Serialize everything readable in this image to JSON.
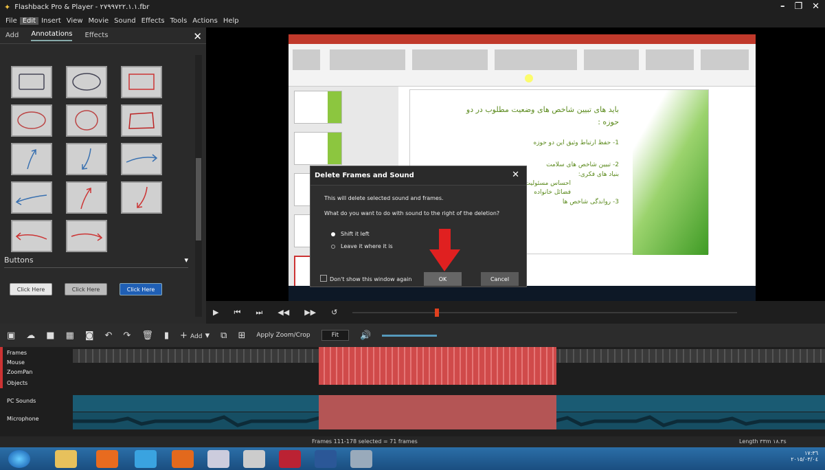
{
  "window": {
    "title": "Flashback Pro & Player - ٢٧٩٩٧٢٢.١.١.fbr",
    "min": "–",
    "max": "❐",
    "close": "✕"
  },
  "menu": [
    "File",
    "Edit",
    "Insert",
    "View",
    "Movie",
    "Sound",
    "Effects",
    "Tools",
    "Actions",
    "Help"
  ],
  "panel": {
    "tabs": [
      "Add",
      "Annotations",
      "Effects"
    ],
    "close": "✕",
    "buttons_header": "Buttons",
    "buttons_toggle": "▾",
    "sample_buttons": [
      "Click Here",
      "Click Here",
      "Click Here"
    ]
  },
  "slide": {
    "line1": "باید های تبیین شاخص های وضعیت مطلوب در دو",
    "line2": "حوزه :",
    "line3": "1- حفظ ارتباط وثیق این دو حوزه",
    "line4": "2- تبیین شاخص های سلامت",
    "line5": "بنیاد های فکری:",
    "line6": "احساس مسئولیت",
    "line7": "فضائل خانواده",
    "line8": "3- رواندگی شاخص ها"
  },
  "dialog": {
    "title": "Delete Frames and Sound",
    "close": "✕",
    "msg1": "This will delete selected sound and frames.",
    "msg2": "What do you want to do with sound to the right of the deletion?",
    "opt1": "Shift it left",
    "opt2": "Leave it where it is",
    "dont_show": "Don't show this window again",
    "ok": "OK",
    "cancel": "Cancel"
  },
  "toolbar": {
    "add": "Add",
    "apply_zoom": "Apply Zoom/Crop",
    "zoom": "Fit"
  },
  "tracks": [
    "Frames",
    "Mouse",
    "ZoomPan",
    "Objects",
    "PC Sounds",
    "Microphone"
  ],
  "status": {
    "frames": "Frames 111-178 selected = 71 frames",
    "length": "Length ٣٣m ١٨.٣s"
  },
  "clock": {
    "time": "١٧:٣٦",
    "date": "٢٠١٥/٠٣/٠٤"
  },
  "colors": {
    "accent": "#e02020",
    "selection": "#d04a4a",
    "audio": "#1a5b73"
  }
}
